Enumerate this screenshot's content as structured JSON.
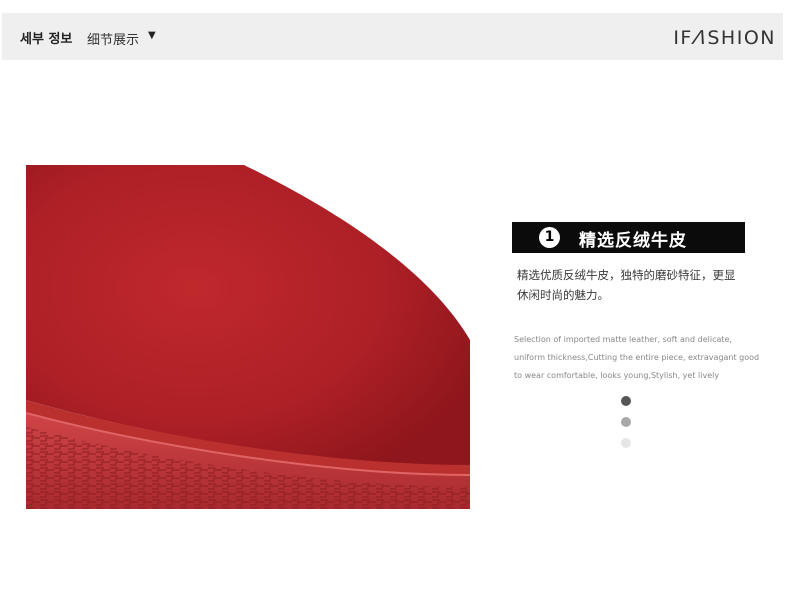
{
  "header": {
    "korean_label": "세부 정보",
    "chinese_label": "细节展示",
    "arrow": "▼",
    "brand": "IF∕\\SHION"
  },
  "feature": {
    "number": "1",
    "title": "精选反绒牛皮",
    "description_cn_line1": "精选优质反绒牛皮，独特的磨砂特征，更显",
    "description_cn_line2": "休闲时尚的魅力。",
    "description_en_line1": "Selection of imported matte leather, soft and delicate,",
    "description_en_line2": "uniform thickness,Cutting the entire piece, extravagant good",
    "description_en_line3": "to wear comfortable, looks young,Stylish, yet lively"
  },
  "colors": {
    "header_bg": "#efefef",
    "title_bar_bg": "#0b0b0b",
    "suede_red": "#b3242a",
    "sole_red": "#c0393a"
  },
  "pagination": {
    "active_index": 1,
    "total": 3
  }
}
